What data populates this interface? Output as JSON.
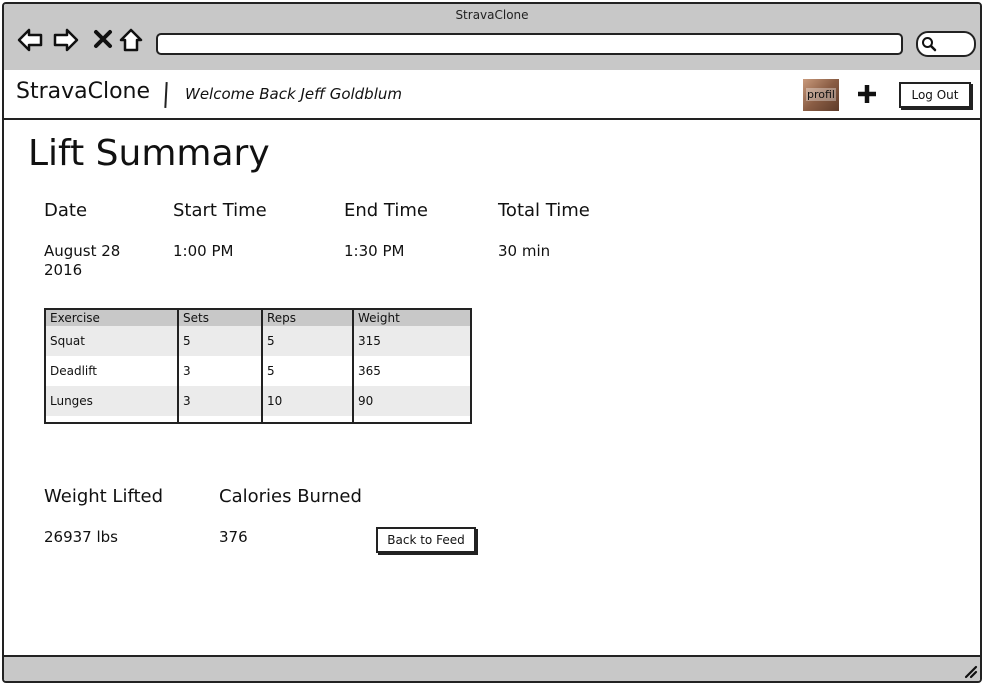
{
  "window": {
    "title": "StravaClone"
  },
  "browser": {
    "url": ""
  },
  "appbar": {
    "brand": "StravaClone",
    "welcome": "Welcome Back Jeff Goldblum",
    "avatar_label": "profil",
    "logout_label": "Log Out"
  },
  "summary": {
    "title": "Lift Summary",
    "date": {
      "label": "Date",
      "value_line1": "August 28",
      "value_line2": "2016"
    },
    "start": {
      "label": "Start Time",
      "value": "1:00 PM"
    },
    "end": {
      "label": "End Time",
      "value": "1:30 PM"
    },
    "total": {
      "label": "Total Time",
      "value": "30 min"
    }
  },
  "table": {
    "headers": [
      "Exercise",
      "Sets",
      "Reps",
      "Weight"
    ],
    "rows": [
      [
        "Squat",
        "5",
        "5",
        "315"
      ],
      [
        "Deadlift",
        "3",
        "5",
        "365"
      ],
      [
        "Lunges",
        "3",
        "10",
        "90"
      ]
    ]
  },
  "totals": {
    "weight": {
      "label": "Weight Lifted",
      "value": "26937 lbs"
    },
    "calories": {
      "label": "Calories Burned",
      "value": "376"
    }
  },
  "back_button": "Back to Feed",
  "icons": {
    "back": "back-arrow-icon",
    "forward": "forward-arrow-icon",
    "stop": "close-icon",
    "home": "home-icon",
    "search": "search-icon",
    "add": "plus-icon",
    "resize": "resize-grip-icon"
  }
}
